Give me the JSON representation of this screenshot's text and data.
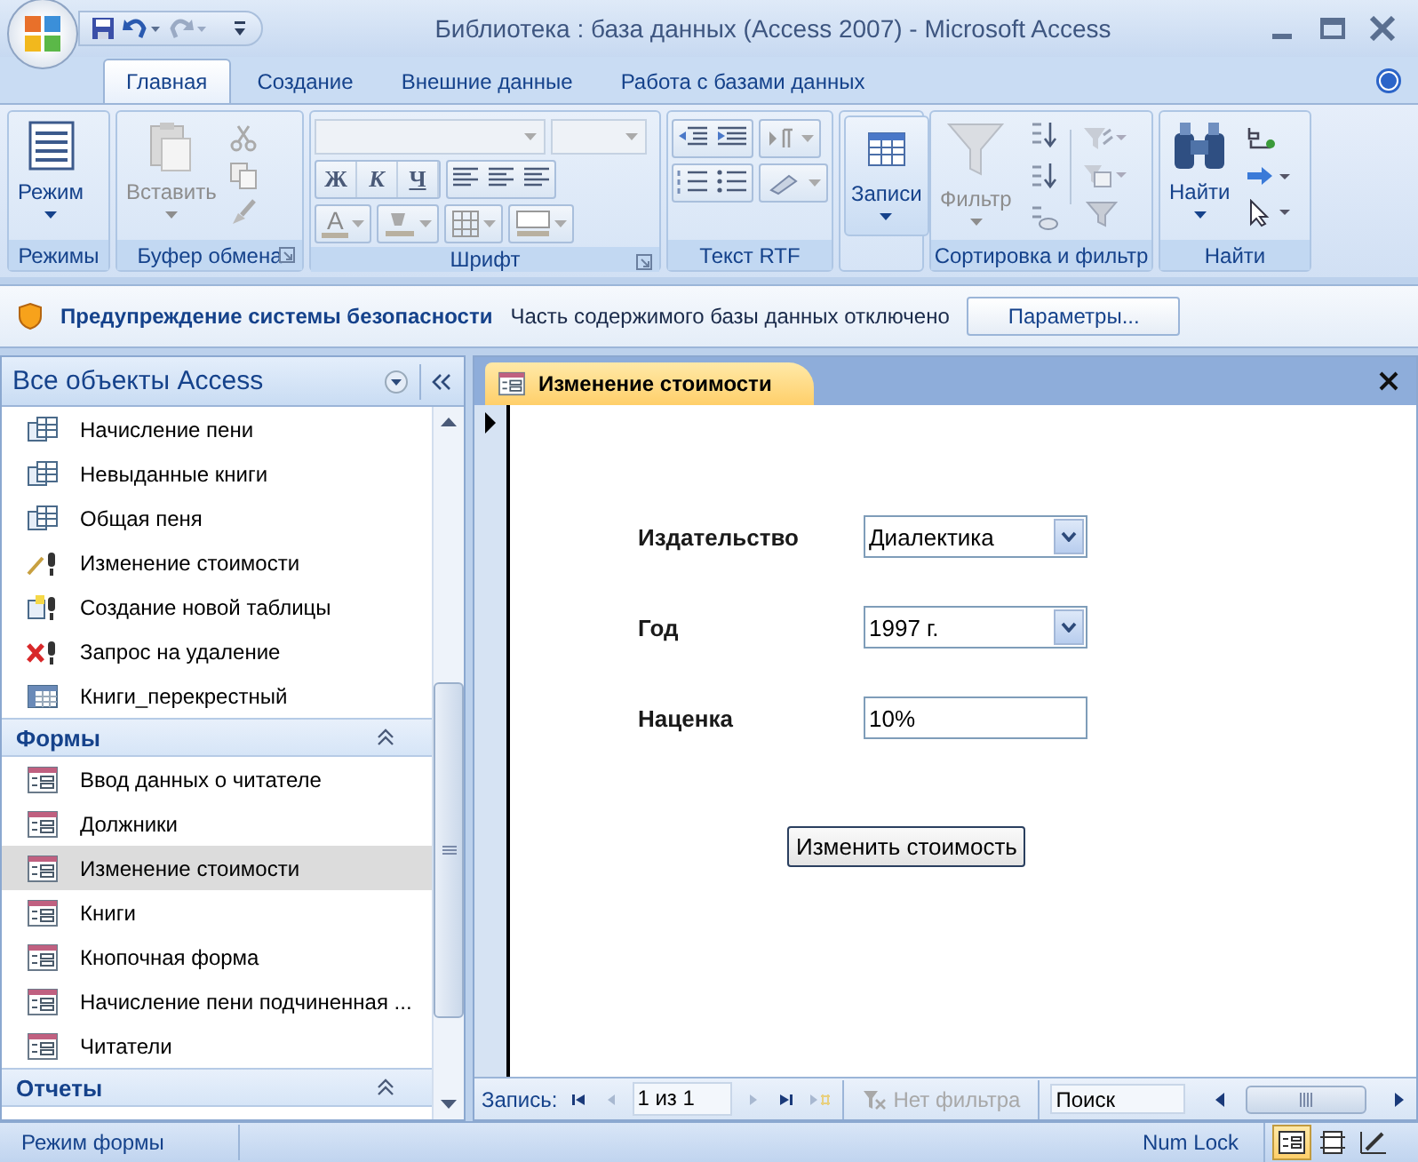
{
  "window": {
    "title": "Библиотека : база данных (Access 2007) - Microsoft Access"
  },
  "tabs": [
    {
      "label": "Главная",
      "selected": true
    },
    {
      "label": "Создание",
      "selected": false
    },
    {
      "label": "Внешние данные",
      "selected": false
    },
    {
      "label": "Работа с базами данных",
      "selected": false
    }
  ],
  "ribbon": {
    "groups": [
      {
        "kind": "views",
        "label": "Режимы",
        "large_button": {
          "kind": "view",
          "label": "Режим",
          "disabled": false
        }
      },
      {
        "kind": "clipboard",
        "label": "Буфер обмена",
        "launcher": true,
        "large_button": {
          "kind": "paste",
          "label": "Вставить",
          "disabled": true
        }
      },
      {
        "kind": "font",
        "label": "Шрифт",
        "launcher": true,
        "style_buttons": [
          {
            "kind": "bold",
            "label": "Ж"
          },
          {
            "kind": "italic",
            "label": "К"
          },
          {
            "kind": "underline",
            "label": "Ч"
          }
        ],
        "color_letter": "A"
      },
      {
        "kind": "rtf",
        "label": "Текст RTF"
      },
      {
        "kind": "records",
        "large_button": {
          "kind": "records",
          "label": "Записи",
          "disabled": false
        }
      },
      {
        "kind": "sort",
        "label": "Сортировка и фильтр",
        "large_button": {
          "kind": "filter",
          "label": "Фильтр",
          "disabled": true
        }
      },
      {
        "kind": "find",
        "label": "Найти",
        "large_button": {
          "kind": "find",
          "label": "Найти",
          "disabled": false
        }
      }
    ]
  },
  "security_bar": {
    "title": "Предупреждение системы безопасности",
    "message": "Часть содержимого базы данных отключено",
    "button": "Параметры..."
  },
  "nav": {
    "title": "Все объекты Access",
    "groups": [
      {
        "items": [
          {
            "kind": "query-select",
            "label": "Начисление пени",
            "selected": false
          },
          {
            "kind": "query-select",
            "label": "Невыданные книги",
            "selected": false
          },
          {
            "kind": "query-select",
            "label": "Общая пеня",
            "selected": false
          },
          {
            "kind": "query-update",
            "label": "Изменение стоимости",
            "selected": false
          },
          {
            "kind": "query-make",
            "label": "Создание новой таблицы",
            "selected": false
          },
          {
            "kind": "query-delete",
            "label": "Запрос на удаление",
            "selected": false
          },
          {
            "kind": "query-crosstab",
            "label": "Книги_перекрестный",
            "selected": false
          }
        ]
      },
      {
        "title": "Формы",
        "expanded": true,
        "items": [
          {
            "kind": "form",
            "label": "Ввод данных о читателе",
            "selected": false
          },
          {
            "kind": "form",
            "label": "Должники",
            "selected": false
          },
          {
            "kind": "form",
            "label": "Изменение стоимости",
            "selected": true
          },
          {
            "kind": "form",
            "label": "Книги",
            "selected": false
          },
          {
            "kind": "form",
            "label": "Кнопочная форма",
            "selected": false
          },
          {
            "kind": "form",
            "label": "Начисление пени подчиненная ...",
            "selected": false
          },
          {
            "kind": "form",
            "label": "Читатели",
            "selected": false
          }
        ]
      },
      {
        "title": "Отчеты",
        "expanded": true
      }
    ]
  },
  "document": {
    "tab": "Изменение стоимости",
    "fields": [
      {
        "kind": "combo",
        "label": "Издательство",
        "value": "Диалектика"
      },
      {
        "kind": "combo",
        "label": "Год",
        "value": "1997 г."
      },
      {
        "kind": "text",
        "label": "Наценка",
        "value": "10%"
      }
    ],
    "button": "Изменить стоимость",
    "record_nav": {
      "label": "Запись:",
      "position": "1 из 1",
      "filter": {
        "label": "Нет фильтра",
        "disabled": true
      },
      "search_placeholder": "Поиск"
    }
  },
  "status_bar": {
    "mode": "Режим формы",
    "num_lock": "Num Lock",
    "view_buttons": [
      {
        "kind": "form",
        "selected": true
      },
      {
        "kind": "layout",
        "selected": false
      },
      {
        "kind": "design",
        "selected": false
      }
    ]
  }
}
